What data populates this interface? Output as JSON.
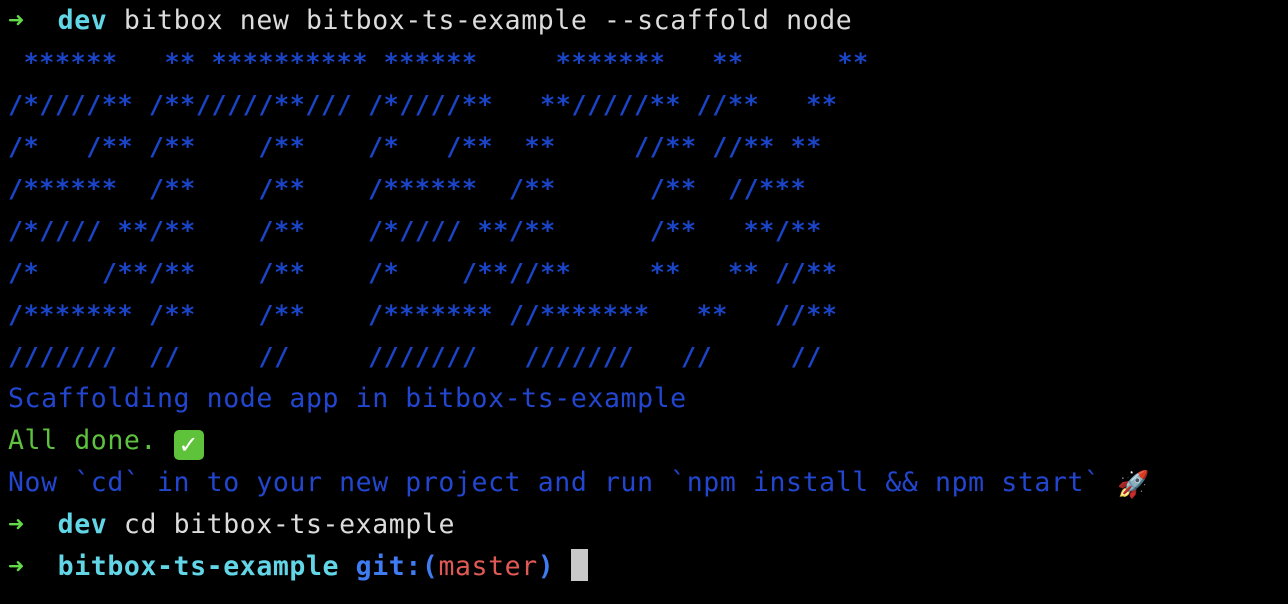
{
  "prompt": {
    "arrow": "➜",
    "dir_1": "dev",
    "command_1": "bitbox new bitbox-ts-example --scaffold node",
    "dir_2": "dev",
    "command_2": "cd bitbox-ts-example",
    "dir_3": "bitbox-ts-example",
    "git_label": "git:(",
    "branch": "master",
    "git_close": ")"
  },
  "banner": [
    " ******   ** ********** ******     *******   **      **",
    "/*////** /**/////**/// /*////**   **/////** //**   **",
    "/*   /** /**    /**    /*   /**  **     //** //** **",
    "/******  /**    /**    /******  /**      /**  //***",
    "/*//// **/**    /**    /*//// **/**      /**   **/**",
    "/*    /**/**    /**    /*    /**//**     **   ** //**",
    "/******* /**    /**    /******* //*******   **   //**",
    "///////  //     //     ///////   ///////   //     //"
  ],
  "output": {
    "scaffolding": "Scaffolding node app in bitbox-ts-example",
    "done": "All done.",
    "done_icon": "✓",
    "next_steps": "Now `cd` in to your new project and run `npm install && npm start`",
    "rocket_icon": "🚀"
  },
  "colors": {
    "background": "#000000",
    "prompt_arrow": "#63d94a",
    "directory": "#62d6e6",
    "banner_blue": "#1a45c9",
    "text_blue": "#2346d0",
    "success_green": "#5fc23f",
    "git_label": "#3f7bf2",
    "branch": "#e05a55"
  }
}
